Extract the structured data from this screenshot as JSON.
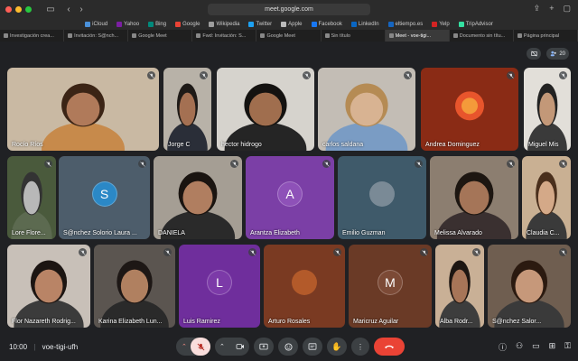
{
  "browser": {
    "url": "meet.google.com",
    "bookmarks": [
      {
        "label": "iCloud",
        "color": "#4a90d9"
      },
      {
        "label": "Yahoo",
        "color": "#7b1fa2"
      },
      {
        "label": "Bing",
        "color": "#00897b"
      },
      {
        "label": "Google",
        "color": "#ea4335"
      },
      {
        "label": "Wikipedia",
        "color": "#9e9e9e"
      },
      {
        "label": "Twitter",
        "color": "#1da1f2"
      },
      {
        "label": "Apple",
        "color": "#bbbbbb"
      },
      {
        "label": "Facebook",
        "color": "#1877f2"
      },
      {
        "label": "LinkedIn",
        "color": "#0a66c2"
      },
      {
        "label": "eltiempo.es",
        "color": "#1565c0"
      },
      {
        "label": "Yelp",
        "color": "#d32323"
      },
      {
        "label": "TripAdvisor",
        "color": "#34e0a1"
      }
    ],
    "tabs": [
      {
        "label": "Investigación crea...",
        "active": false
      },
      {
        "label": "Invitación: S@nch...",
        "active": false
      },
      {
        "label": "Google Meet",
        "active": false
      },
      {
        "label": "Fwd: Invitación: S...",
        "active": false
      },
      {
        "label": "Google Meet",
        "active": false
      },
      {
        "label": "Sin título",
        "active": false
      },
      {
        "label": "Meet - voe-tigi...",
        "active": true
      },
      {
        "label": "Documento sin títu...",
        "active": false
      },
      {
        "label": "Página principal",
        "active": false
      }
    ]
  },
  "meet": {
    "participant_count": "20",
    "time": "10:00",
    "meeting_code": "voe-tigi-ufh",
    "participants": [
      {
        "name": "Rocío Ríos",
        "type": "video",
        "bg": "#c9b9a3",
        "skin": "#b07a5a",
        "hair": "#3b2415",
        "shirt": "#c78a4b"
      },
      {
        "name": "Jorge C",
        "type": "video",
        "bg": "#b8b2a8",
        "skin": "#a47052",
        "hair": "#1e1a17",
        "shirt": "#2a2e38"
      },
      {
        "name": "hector hidrogo",
        "type": "video",
        "bg": "#d6d3cd",
        "skin": "#a06e4e",
        "hair": "#141210",
        "shirt": "#252525"
      },
      {
        "name": "carlos saldana",
        "type": "video",
        "bg": "#c3bdb5",
        "skin": "#d8b392",
        "hair": "#b58b54",
        "shirt": "#7a9cc4"
      },
      {
        "name": "Andrea Dominguez",
        "type": "image",
        "bg": "#8a2b15"
      },
      {
        "name": "Miguel Mis",
        "type": "video",
        "bg": "#e2dfd9",
        "skin": "#c39878",
        "hair": "#222",
        "shirt": "#3a3a3a"
      },
      {
        "name": "Lore Flore...",
        "type": "video",
        "bg": "#4a5a3c",
        "skin": "#b8b8b8",
        "hair": "#333",
        "shirt": "#5c6a50"
      },
      {
        "name": "S@nchez Solorio Laura ...",
        "type": "avatar",
        "bg": "#4d5d6b",
        "initial": "S",
        "color": "#2b88c6"
      },
      {
        "name": "DANIELA",
        "type": "video",
        "bg": "#a59e94",
        "skin": "#b07e60",
        "hair": "#1a1410",
        "shirt": "#2a2a2a"
      },
      {
        "name": "Arantza Elizabeth",
        "type": "avatar",
        "bg": "#7b3fa6",
        "initial": "A",
        "color": "#8e51b8"
      },
      {
        "name": "Emilio Guzman",
        "type": "avatar",
        "bg": "#3f5a6a",
        "initial": "",
        "color": "#7a8a96"
      },
      {
        "name": "Melissa Alvarado",
        "type": "video",
        "bg": "#8c7e70",
        "skin": "#a57558",
        "hair": "#1d1611",
        "shirt": "#3a3030"
      },
      {
        "name": "Claudia C...",
        "type": "video",
        "bg": "#c9b093",
        "skin": "#d4a988",
        "hair": "#4a2f1c",
        "shirt": "#3a3a3a"
      },
      {
        "name": "Flor Nazareth Rodrig...",
        "type": "video",
        "bg": "#c8c0b8",
        "skin": "#b98466",
        "hair": "#1c1512",
        "shirt": "#3b3b3b"
      },
      {
        "name": "Karina Elizabeth Lun...",
        "type": "video",
        "bg": "#5b5550",
        "skin": "#b08060",
        "hair": "#1d1715",
        "shirt": "#2a2a2a"
      },
      {
        "name": "Luis Ramirez",
        "type": "avatar",
        "bg": "#6f2e9c",
        "initial": "L",
        "color": "#7c3aa8"
      },
      {
        "name": "Arturo Rosales",
        "type": "avatar",
        "bg": "#7a3a22",
        "initial": "",
        "color": "#b35a2a"
      },
      {
        "name": "Maricruz Aguilar",
        "type": "avatar",
        "bg": "#6a3a26",
        "initial": "M",
        "color": "#7c4a36"
      },
      {
        "name": "Alba Rodr...",
        "type": "video",
        "bg": "#c9b096",
        "skin": "#a77558",
        "hair": "#1d1612",
        "shirt": "#3d3d3d"
      },
      {
        "name": "S@nchez Salor...",
        "type": "video",
        "bg": "#6f5e50",
        "skin": "#c6987a",
        "hair": "#2b1a10",
        "shirt": "#3a3a3a"
      }
    ]
  }
}
